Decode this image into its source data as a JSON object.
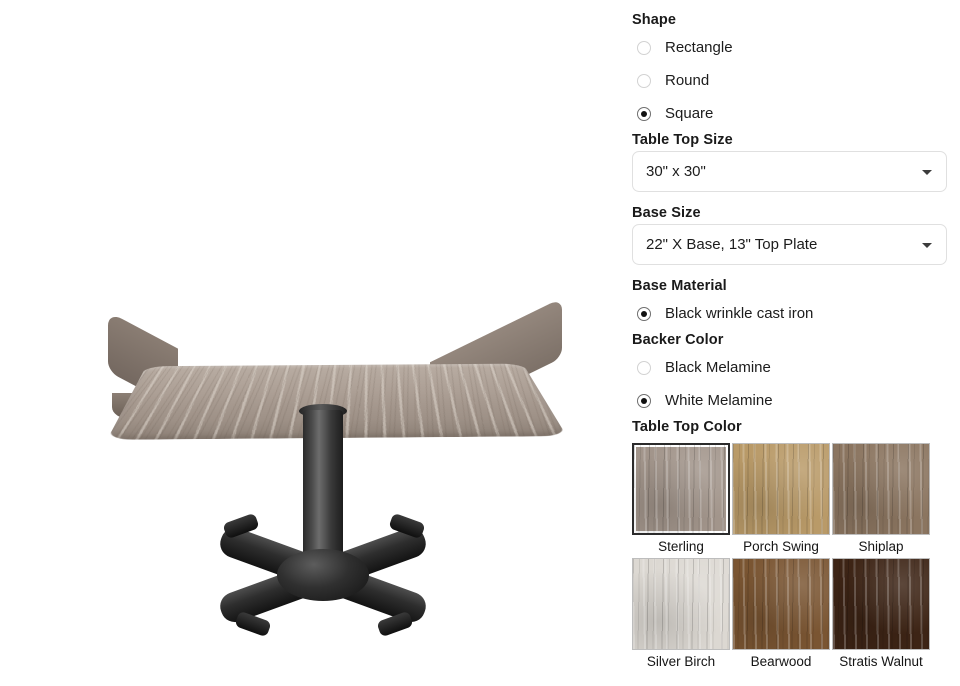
{
  "product_image": {
    "alt": "square woodgrain table top on black cast iron X base",
    "top_color": "#ada096",
    "base_color": "#1d1d1d"
  },
  "options": {
    "shape": {
      "title": "Shape",
      "items": [
        {
          "label": "Rectangle",
          "selected": false
        },
        {
          "label": "Round",
          "selected": false
        },
        {
          "label": "Square",
          "selected": true
        }
      ]
    },
    "table_top_size": {
      "title": "Table Top Size",
      "value": "30\" x 30\""
    },
    "base_size": {
      "title": "Base Size",
      "value": "22\" X Base, 13\" Top Plate"
    },
    "base_material": {
      "title": "Base Material",
      "items": [
        {
          "label": "Black wrinkle cast iron",
          "selected": true
        }
      ]
    },
    "backer_color": {
      "title": "Backer Color",
      "items": [
        {
          "label": "Black Melamine",
          "selected": false
        },
        {
          "label": "White Melamine",
          "selected": true
        }
      ]
    },
    "table_top_color": {
      "title": "Table Top Color",
      "swatches": [
        {
          "label": "Sterling",
          "color": "#a2958b",
          "selected": true
        },
        {
          "label": "Porch Swing",
          "color": "#b99a68",
          "selected": false
        },
        {
          "label": "Shiplap",
          "color": "#8b7560",
          "selected": false
        },
        {
          "label": "Silver Birch",
          "color": "#dcd8d2",
          "selected": false
        },
        {
          "label": "Bearwood",
          "color": "#7a5532",
          "selected": false
        },
        {
          "label": "Stratis Walnut",
          "color": "#3d2415",
          "selected": false
        }
      ]
    }
  }
}
